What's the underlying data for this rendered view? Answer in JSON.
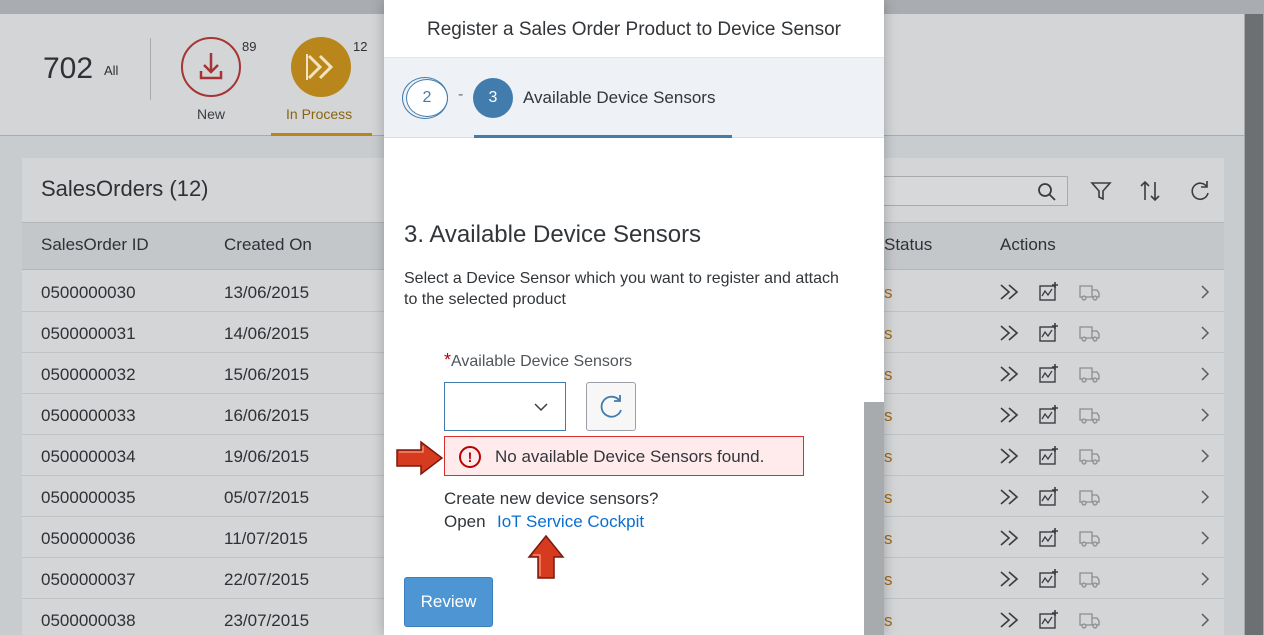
{
  "app": {
    "total_count": "702",
    "total_label": "All",
    "tabs": [
      {
        "label": "New",
        "count": "89"
      },
      {
        "label": "In Process",
        "count": "12"
      }
    ],
    "list_title": "SalesOrders (12)",
    "columns": [
      "SalesOrder ID",
      "Created On",
      "Status",
      "Actions"
    ],
    "rows": [
      {
        "id": "0500000030",
        "date": "13/06/2015"
      },
      {
        "id": "0500000031",
        "date": "14/06/2015"
      },
      {
        "id": "0500000032",
        "date": "15/06/2015"
      },
      {
        "id": "0500000033",
        "date": "16/06/2015"
      },
      {
        "id": "0500000034",
        "date": "19/06/2015"
      },
      {
        "id": "0500000035",
        "date": "05/07/2015"
      },
      {
        "id": "0500000036",
        "date": "11/07/2015"
      },
      {
        "id": "0500000037",
        "date": "22/07/2015"
      },
      {
        "id": "0500000038",
        "date": "23/07/2015"
      }
    ],
    "status_fragment": "s"
  },
  "dialog": {
    "title": "Register a Sales Order Product to Device Sensor",
    "wizard": {
      "prev_step": "2",
      "separator": "-",
      "current_step": "3",
      "current_label": "Available Device Sensors"
    },
    "section_title": "3. Available Device Sensors",
    "section_description": "Select a Device Sensor which you want to register and attach to the selected product",
    "field": {
      "required_mark": "*",
      "label": "Available Device Sensors",
      "value": ""
    },
    "error_message": "No available Device Sensors found.",
    "create_question": "Create new device sensors?",
    "open_label": "Open",
    "cockpit_link": "IoT Service Cockpit",
    "review_button": "Review"
  },
  "colors": {
    "accent": "#427cac",
    "link": "#0a6ed1",
    "error_border": "#d43030",
    "error_bg": "#ffebeb",
    "review_button": "#4e95d3",
    "annotation_arrow": "#d63a1f"
  },
  "icons": [
    "download-icon",
    "fast-forward-icon",
    "search-icon",
    "filter-icon",
    "sort-icon",
    "refresh-icon",
    "chevron-down-icon",
    "error-icon",
    "chevron-right-icon",
    "truck-icon",
    "add-chart-icon"
  ]
}
